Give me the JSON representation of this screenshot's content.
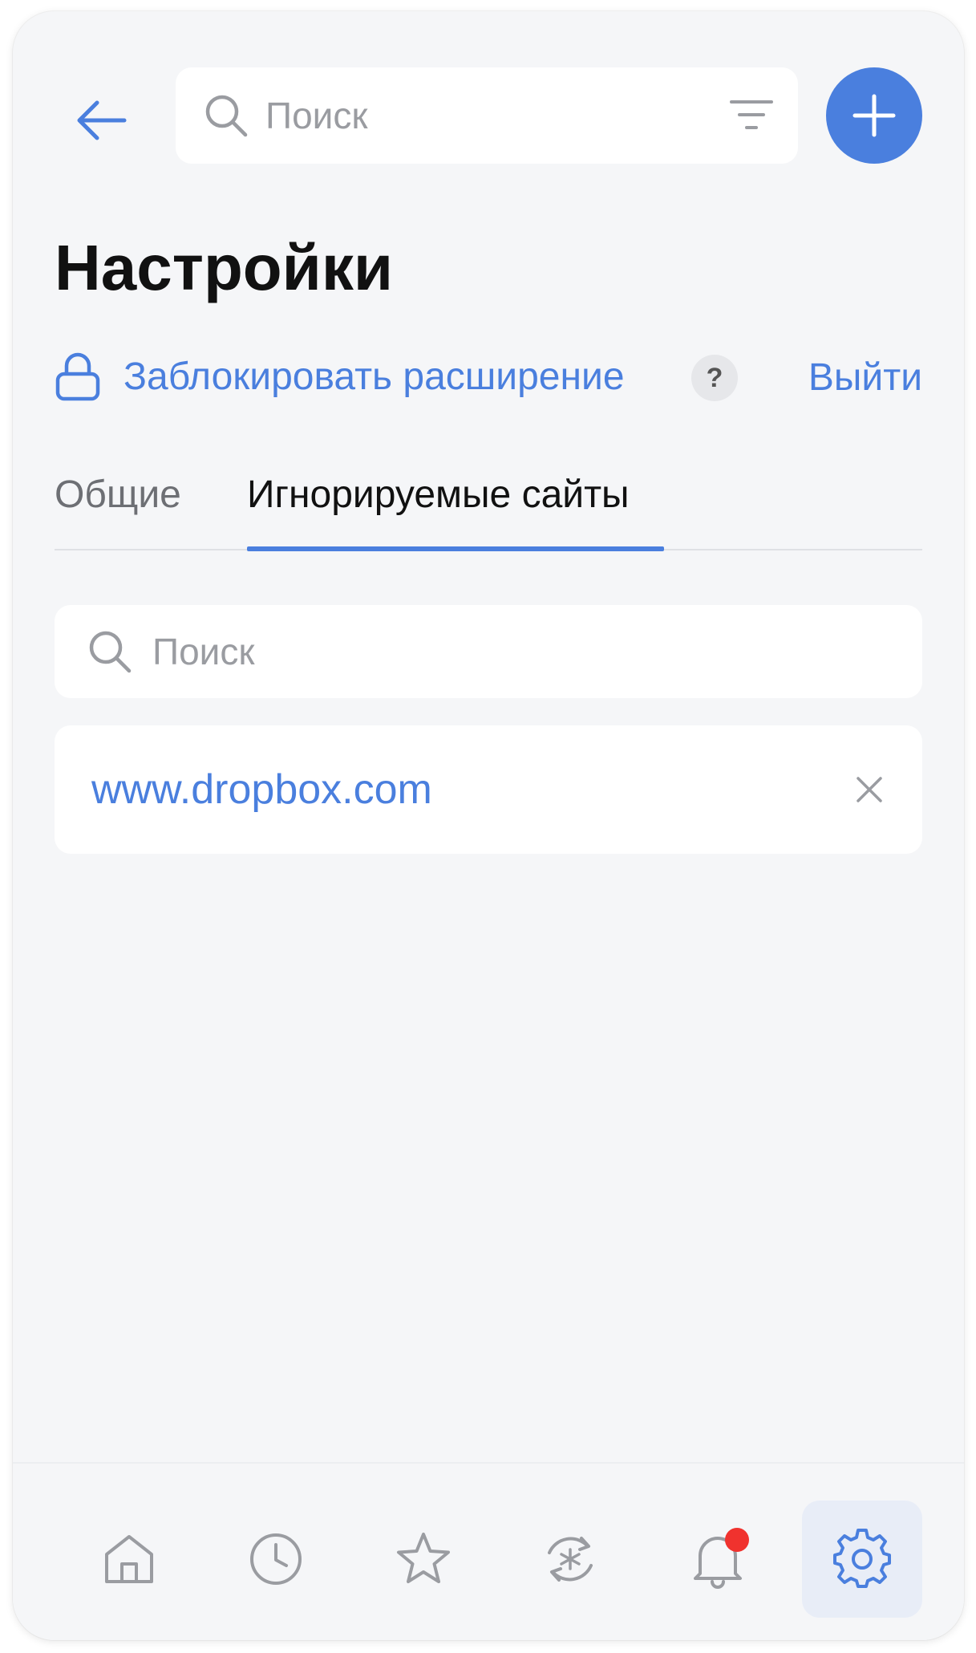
{
  "header": {
    "search_placeholder": "Поиск",
    "icons": {
      "back": "back-arrow-icon",
      "search": "search-icon",
      "filter": "filter-icon",
      "add": "plus-icon"
    }
  },
  "page": {
    "title": "Настройки",
    "lock_link": "Заблокировать расширение",
    "help": "?",
    "logout": "Выйти"
  },
  "tabs": [
    {
      "label": "Общие",
      "active": false
    },
    {
      "label": "Игнорируемые сайты",
      "active": true
    }
  ],
  "ignored_sites": {
    "search_placeholder": "Поиск",
    "items": [
      {
        "url": "www.dropbox.com"
      }
    ]
  },
  "bottom_nav": {
    "items": [
      {
        "icon": "home-icon",
        "active": false
      },
      {
        "icon": "clock-icon",
        "active": false
      },
      {
        "icon": "star-icon",
        "active": false
      },
      {
        "icon": "generator-icon",
        "active": false
      },
      {
        "icon": "bell-icon",
        "active": false,
        "has_notification": true
      },
      {
        "icon": "gear-icon",
        "active": true
      }
    ]
  },
  "colors": {
    "accent": "#4a7fde",
    "background": "#f5f6f8",
    "notification": "#f0322e",
    "muted_text": "#9a9ca1"
  }
}
